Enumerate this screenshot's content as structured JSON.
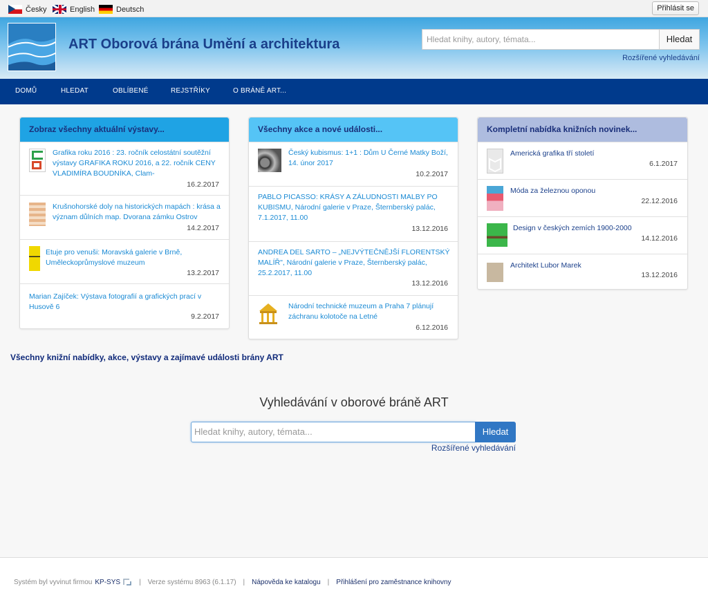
{
  "languages": [
    {
      "label": "Česky",
      "flag": "flag-cz-icon"
    },
    {
      "label": "English",
      "flag": "flag-gb-icon"
    },
    {
      "label": "Deutsch",
      "flag": "flag-de-icon"
    }
  ],
  "login_label": "Přihlásit se",
  "header": {
    "title": "ART Oborová brána Umění a architektura",
    "search_placeholder": "Hledat knihy, autory, témata...",
    "search_button": "Hledat",
    "advanced_link": "Rozšířené vyhledávání"
  },
  "nav": [
    "DOMŮ",
    "HLEDAT",
    "OBLÍBENÉ",
    "REJSTŘÍKY",
    "O BRÁNĚ ART..."
  ],
  "panels": [
    {
      "title": "Zobraz všechny aktuální výstavy...",
      "items": [
        {
          "text": "Grafika roku 2016 : 23. ročník celostátní soutěžní výstavy GRAFIKA ROKU 2016, a 22. ročník CENY VLADIMÍRA BOUDNÍKA, Clam-",
          "date": "16.2.2017"
        },
        {
          "text": "Krušnohorské doly na historických mapách : krása a význam důlních map. Dvorana zámku Ostrov",
          "date": "14.2.2017"
        },
        {
          "text": "Etuje pro venuši: Moravská galerie v Brně, Uměleckoprůmyslové muzeum",
          "date": "13.2.2017"
        },
        {
          "text": "Marian Zajíček: Výstava fotografií a grafických prací v Husově 6",
          "date": "9.2.2017"
        }
      ]
    },
    {
      "title": "Všechny akce a nové události...",
      "items": [
        {
          "text": "Český kubismus: 1+1 : Dům U Černé Matky Boží, 14. únor 2017",
          "date": "10.2.2017"
        },
        {
          "text": "PABLO PICASSO: KRÁSY A ZÁLUDNOSTI MALBY PO KUBISMU, Národní galerie v Praze, Šternberský palác, 7.1.2017, 11.00",
          "date": "13.12.2016"
        },
        {
          "text": "ANDREA DEL SARTO – „NEJVÝTEČNĚJŠÍ FLORENTSKÝ MALÍŘ\", Národní galerie v Praze, Šternberský palác, 25.2.2017, 11.00",
          "date": "13.12.2016"
        },
        {
          "text": "Národní technické muzeum a Praha 7 plánují záchranu kolotoče na Letné",
          "date": "6.12.2016"
        }
      ]
    },
    {
      "title": "Kompletní nabídka knižních novinek...",
      "items": [
        {
          "text": "Americká grafika tří století",
          "date": "6.1.2017"
        },
        {
          "text": "Móda za železnou oponou",
          "date": "22.12.2016"
        },
        {
          "text": "Design v českých zemích 1900-2000",
          "date": "14.12.2016"
        },
        {
          "text": "Architekt Lubor Marek",
          "date": "13.12.2016"
        }
      ]
    }
  ],
  "all_news_link": "Všechny knižní nabídky, akce, výstavy a zajímavé události brány ART",
  "big_search": {
    "title": "Vyhledávání v oborové bráně ART",
    "placeholder": "Hledat knihy, autory, témata...",
    "button": "Hledat",
    "advanced_link": "Rozšířené vyhledávání"
  },
  "footer": {
    "developed_by": "Systém byl vyvinut firmou",
    "company": "KP-SYS",
    "version": "Verze systému 8963 (6.1.17)",
    "help": "Nápověda ke katalogu",
    "staff_login": "Přihlášení pro zaměstnance knihovny",
    "separator": "|"
  }
}
